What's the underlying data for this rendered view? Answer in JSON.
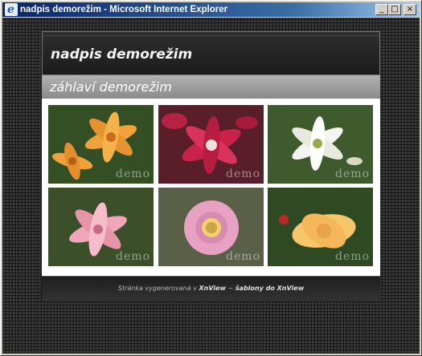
{
  "window": {
    "title": "nadpis demorežim - Microsoft Internet Explorer",
    "buttons": {
      "minimize": "_",
      "maximize": "□",
      "close": "×"
    }
  },
  "page": {
    "header_title": "nadpis demorežim",
    "subheader_title": "záhlaví demorežim",
    "watermark": "demo",
    "footer": {
      "prefix": "Stránka vygenerovaná v",
      "link1": "XnView",
      "separator": "~",
      "link2": "šablony do XnView"
    }
  },
  "gallery": {
    "thumbnails": [
      {
        "subject": "orange-lily",
        "petal_color": "#f2a23a",
        "background": "#3d5a2a"
      },
      {
        "subject": "red-lily",
        "petal_color": "#c8224a",
        "background": "#5a1e2a"
      },
      {
        "subject": "white-lily",
        "petal_color": "#f4f4f0",
        "background": "#3f5a2c"
      },
      {
        "subject": "pink-lily",
        "petal_color": "#f0a6b8",
        "background": "#3a4f2a"
      },
      {
        "subject": "pink-gazania",
        "petal_color": "#e7a1c2",
        "background": "#5a6048"
      },
      {
        "subject": "yellow-gladiolus",
        "petal_color": "#f8c66a",
        "background": "#2f4a22"
      }
    ]
  }
}
